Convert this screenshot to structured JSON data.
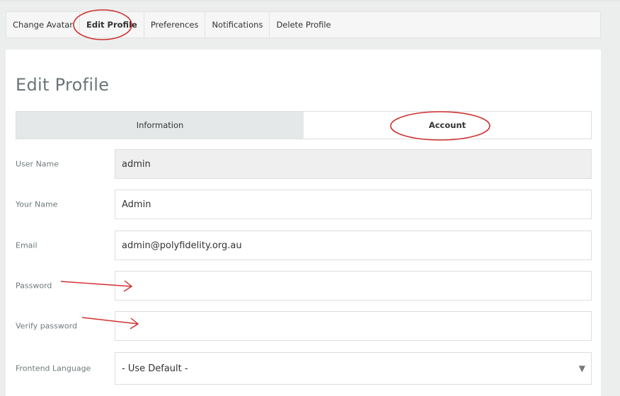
{
  "subnav": {
    "items": [
      {
        "label": "Change Avatar"
      },
      {
        "label": "Edit Profile"
      },
      {
        "label": "Preferences"
      },
      {
        "label": "Notifications"
      },
      {
        "label": "Delete Profile"
      }
    ],
    "active_index": 1
  },
  "page": {
    "title": "Edit Profile"
  },
  "tabs": [
    {
      "label": "Information"
    },
    {
      "label": "Account"
    }
  ],
  "form": {
    "username": {
      "label": "User Name",
      "value": "admin"
    },
    "name": {
      "label": "Your Name",
      "value": "Admin"
    },
    "email": {
      "label": "Email",
      "value": "admin@polyfidelity.org.au"
    },
    "password": {
      "label": "Password",
      "value": ""
    },
    "verify_password": {
      "label": "Verify password",
      "value": ""
    },
    "frontend_language": {
      "label": "Frontend Language",
      "value": "- Use Default -"
    }
  },
  "annotation_color": "#d0302f"
}
